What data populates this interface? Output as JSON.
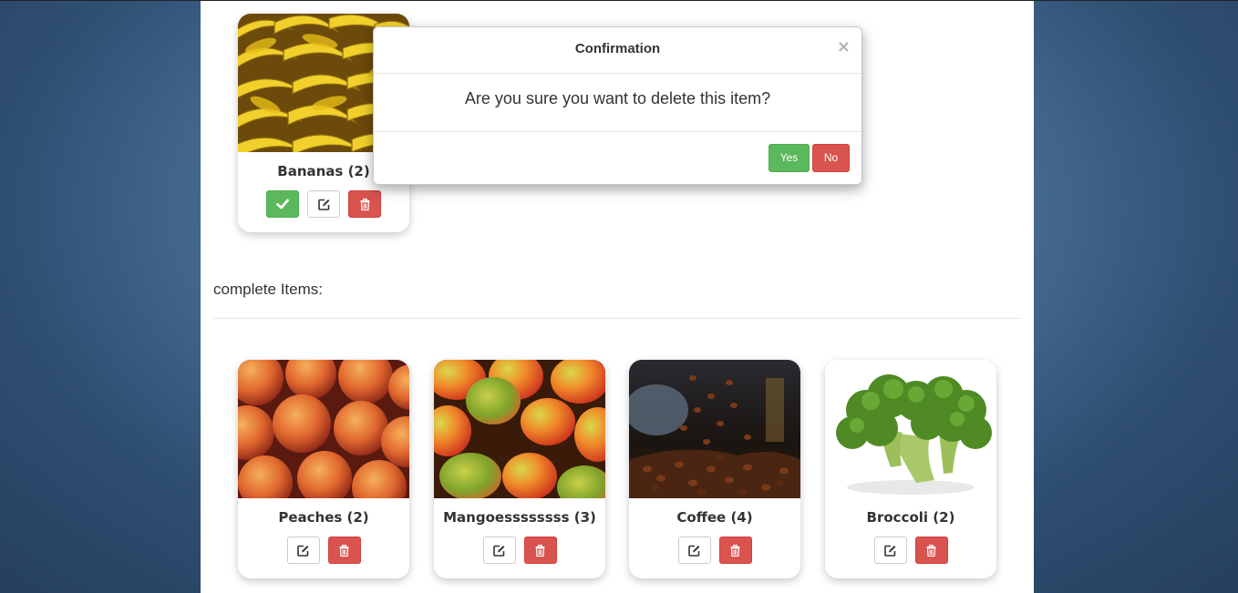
{
  "pending_item": {
    "title": "Bananas (2)",
    "image": "bananas",
    "actions": [
      "check-icon",
      "edit-icon",
      "trash-icon"
    ]
  },
  "section": {
    "title": "complete Items:"
  },
  "complete_items": [
    {
      "title": "Peaches (2)",
      "image": "peaches"
    },
    {
      "title": "Mangoessssssss (3)",
      "image": "mangoes"
    },
    {
      "title": "Coffee (4)",
      "image": "coffee"
    },
    {
      "title": "Broccoli (2)",
      "image": "broccoli"
    }
  ],
  "modal": {
    "title": "Confirmation",
    "close": "×",
    "message": "Are you sure you want to delete this item?",
    "yes": "Yes",
    "no": "No"
  },
  "colors": {
    "success": "#5cb85c",
    "danger": "#d9534f",
    "text": "#333333"
  }
}
